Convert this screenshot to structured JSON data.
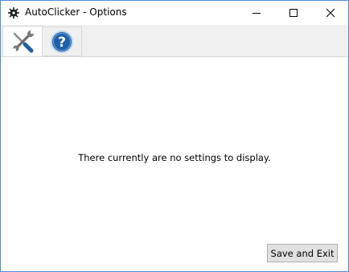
{
  "window": {
    "title": "AutoClicker - Options",
    "controls": {
      "minimize_icon": "minimize-icon",
      "maximize_icon": "maximize-icon",
      "close_icon": "close-icon"
    }
  },
  "tabs": [
    {
      "icon": "tools-icon",
      "selected": true
    },
    {
      "icon": "help-icon",
      "selected": false
    }
  ],
  "main": {
    "message": "There currently are no settings to display.",
    "save_label": "Save and Exit"
  },
  "colors": {
    "window_border": "#4a90d9",
    "tab_strip": "#f0f0f0",
    "button_face": "#e1e1e1",
    "help_blue": "#1f5fa8"
  }
}
